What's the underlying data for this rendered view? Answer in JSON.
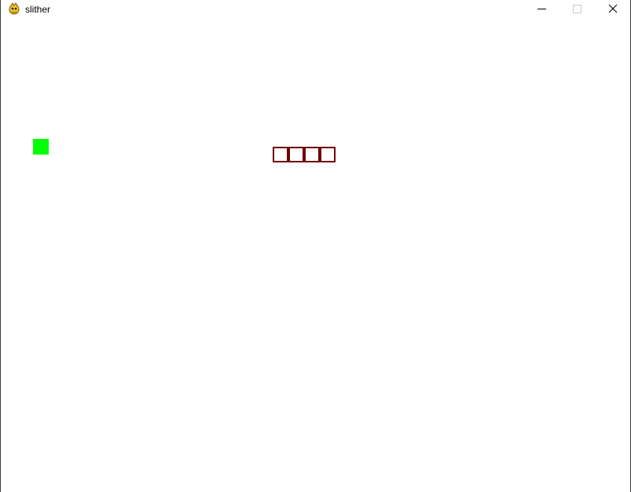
{
  "window": {
    "title": "slither",
    "icon": "pygame-snake-icon",
    "controls": [
      "minimize-icon",
      "maximize-icon",
      "close-icon"
    ]
  },
  "game": {
    "background_color": "#ffffff",
    "food": {
      "color": "#00ff00"
    },
    "snake": {
      "segment_count": 4,
      "outline_color": "#6e0000",
      "fill_color": "#ffffff"
    }
  }
}
